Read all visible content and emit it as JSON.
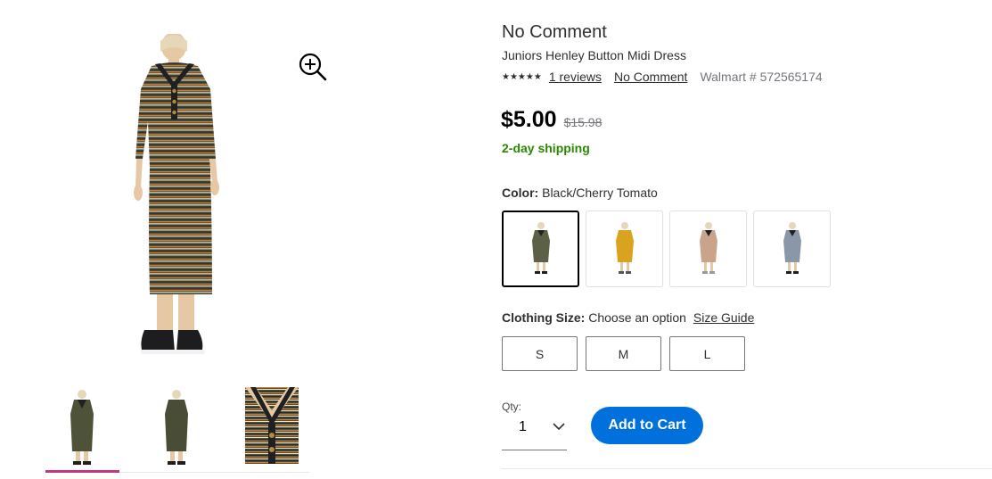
{
  "product": {
    "brand": "No Comment",
    "name": "Juniors Henley Button Midi Dress",
    "stars": "★★★★★",
    "reviews_link": "1 reviews",
    "brand_link": "No Comment",
    "walmart_number": "Walmart # 572565174"
  },
  "pricing": {
    "price": "$5.00",
    "was_price": "$15.98",
    "shipping": "2-day shipping"
  },
  "color": {
    "label": "Color:",
    "selected_value": "Black/Cherry Tomato",
    "swatches": [
      {
        "name": "olive-striped",
        "color": "#5b6046",
        "selected": true
      },
      {
        "name": "mustard",
        "color": "#d9a21f",
        "selected": false
      },
      {
        "name": "tan",
        "color": "#c9a48b",
        "selected": false
      },
      {
        "name": "blue-striped",
        "color": "#8a97a8",
        "selected": false
      }
    ]
  },
  "size": {
    "label": "Clothing Size:",
    "value": "Choose an option",
    "guide_link": "Size Guide",
    "options": [
      "S",
      "M",
      "L"
    ]
  },
  "quantity": {
    "label": "Qty:",
    "value": "1"
  },
  "cart": {
    "add_label": "Add to Cart"
  },
  "colors": {
    "accent": "#0071dc",
    "shipping_green": "#2a8703",
    "thumb_active": "#c4367f"
  }
}
